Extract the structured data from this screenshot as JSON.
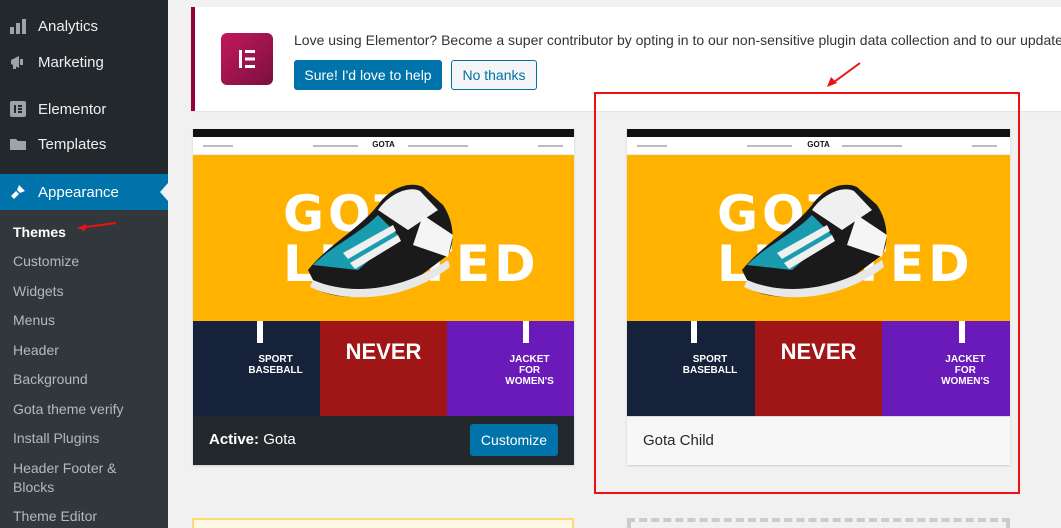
{
  "sidebar": {
    "items": [
      {
        "label": "Analytics",
        "icon": "bar-chart-icon"
      },
      {
        "label": "Marketing",
        "icon": "megaphone-icon"
      },
      {
        "label": "Elementor",
        "icon": "elementor-icon"
      },
      {
        "label": "Templates",
        "icon": "folder-icon"
      },
      {
        "label": "Appearance",
        "icon": "paintbrush-icon"
      }
    ],
    "submenu": [
      "Themes",
      "Customize",
      "Widgets",
      "Menus",
      "Header",
      "Background",
      "Gota theme verify",
      "Install Plugins",
      "Header Footer & Blocks",
      "Theme Editor"
    ]
  },
  "notice": {
    "text": "Love using Elementor? Become a super contributor by opting in to our non-sensitive plugin data collection and to our updates. W",
    "accept_label": "Sure! I'd love to help",
    "decline_label": "No thanks",
    "accent": "#93003c"
  },
  "themes": [
    {
      "active_prefix": "Active:",
      "name": "Gota",
      "action_label": "Customize",
      "shot": {
        "brand": "GOTA",
        "hero_line1": "GOT",
        "hero_line2": "LIMITED",
        "tiles": [
          "SPORT BASEBALL",
          "NEVER",
          "JACKET FOR WOMEN'S"
        ]
      }
    },
    {
      "name": "Gota Child",
      "shot": {
        "brand": "GOTA",
        "hero_line1": "GOT",
        "hero_line2": "LIMITED",
        "tiles": [
          "SPORT BASEBALL",
          "NEVER",
          "JACKET FOR WOMEN'S"
        ]
      }
    }
  ],
  "colors": {
    "wp_blue": "#0073aa",
    "sidebar": "#23282d",
    "annotation_red": "#e11111"
  }
}
